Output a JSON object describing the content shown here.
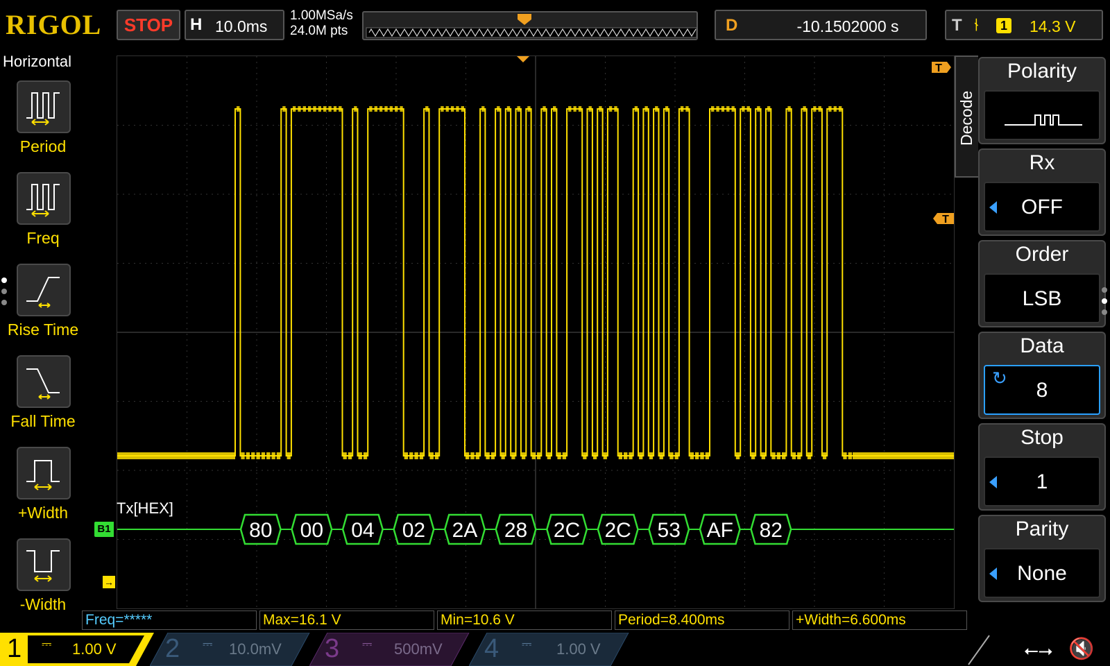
{
  "brand": "RIGOL",
  "colors": {
    "ch1": "#ffe000",
    "decode": "#33dd33",
    "accent": "#2aa0ff",
    "stop": "#ff3b2a",
    "trigger_marker": "#f0a020"
  },
  "top": {
    "run_state": "STOP",
    "timebase_key": "H",
    "timebase_value": "10.0ms",
    "sample_rate": "1.00MSa/s",
    "memory_depth": "24.0M pts",
    "delay_key": "D",
    "delay_value": "-10.1502000 s",
    "trigger_key": "T",
    "trigger_edge_icon": "rising-edge-icon",
    "trigger_source": "1",
    "trigger_level": "14.3 V"
  },
  "left_menu": {
    "title": "Horizontal",
    "items": [
      {
        "label": "Period",
        "icon": "period-icon"
      },
      {
        "label": "Freq",
        "icon": "frequency-icon"
      },
      {
        "label": "Rise Time",
        "icon": "rise-time-icon"
      },
      {
        "label": "Fall Time",
        "icon": "fall-time-icon"
      },
      {
        "label": "+Width",
        "icon": "positive-width-icon"
      },
      {
        "label": "-Width",
        "icon": "negative-width-icon"
      }
    ]
  },
  "plot": {
    "decode_label": "Tx[HEX]",
    "bus_marker": "B1",
    "trigger_tag": "T",
    "bytes": [
      "80",
      "00",
      "04",
      "02",
      "2A",
      "28",
      "2C",
      "2C",
      "53",
      "AF",
      "82"
    ],
    "bit_stream": "0111111110100000000001101100000001111011000001110110101010110101100010101001110101010110011110000010010101110110100100011"
  },
  "right_menu": {
    "tab_label": "Decode",
    "items": [
      {
        "title": "Polarity",
        "value": "",
        "icon": "polarity-pulse-icon",
        "arrow": false,
        "selected": false
      },
      {
        "title": "Rx",
        "value": "OFF",
        "arrow": true,
        "selected": false
      },
      {
        "title": "Order",
        "value": "LSB",
        "arrow": false,
        "selected": false
      },
      {
        "title": "Data",
        "value": "8",
        "icon": "rotate-knob-icon",
        "arrow": false,
        "selected": true
      },
      {
        "title": "Stop",
        "value": "1",
        "arrow": true,
        "selected": false
      },
      {
        "title": "Parity",
        "value": "None",
        "arrow": true,
        "selected": false
      }
    ]
  },
  "measurements": [
    {
      "text": "Freq=*****",
      "color": "#55ccff"
    },
    {
      "text": "Max=16.1 V",
      "color": "#ffe000"
    },
    {
      "text": "Min=10.6 V",
      "color": "#ffe000"
    },
    {
      "text": "Period=8.400ms",
      "color": "#ffe000"
    },
    {
      "text": "+Width=6.600ms",
      "color": "#ffe000"
    }
  ],
  "channels": [
    {
      "num": "1",
      "coupling": "⎓",
      "scale": "1.00 V",
      "color": "#ffe000",
      "active": true
    },
    {
      "num": "2",
      "coupling": "⎓",
      "scale": "10.0mV",
      "color": "#2a6a9a",
      "active": false
    },
    {
      "num": "3",
      "coupling": "⎓",
      "scale": "500mV",
      "color": "#8a2a8a",
      "active": false
    },
    {
      "num": "4",
      "coupling": "⎓",
      "scale": "1.00 V",
      "color": "#2a6a9a",
      "active": false
    }
  ],
  "status": {
    "usb_icon": "usb-icon",
    "sound_icon": "mute-speaker-icon"
  }
}
